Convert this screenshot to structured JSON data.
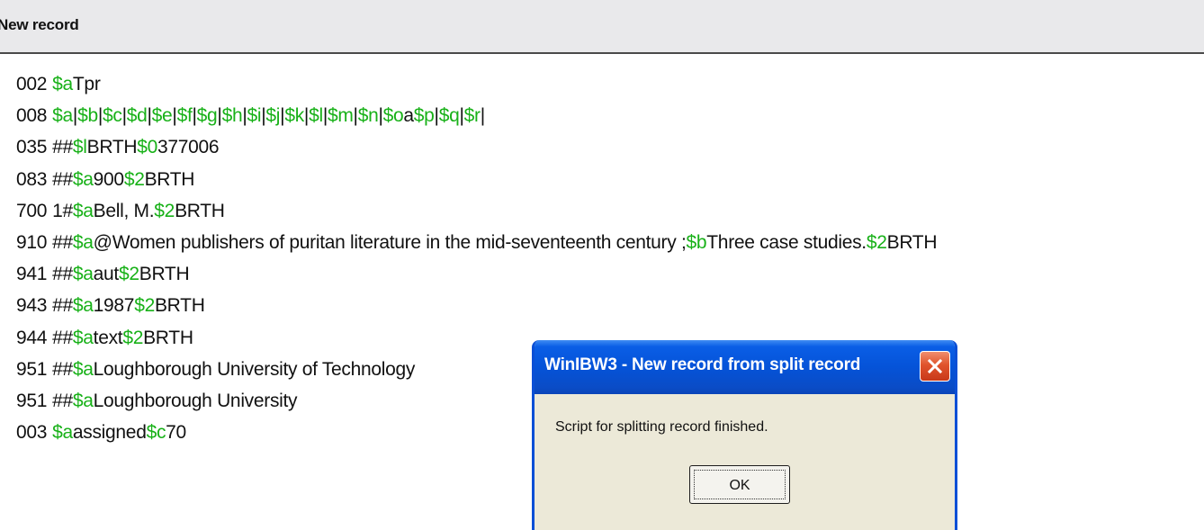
{
  "header": {
    "title": "New record"
  },
  "records": [
    {
      "tag": "002",
      "parts": [
        {
          "t": "$a",
          "s": 1
        },
        {
          "t": "Tpr"
        }
      ]
    },
    {
      "tag": "008",
      "parts": [
        {
          "t": "$a",
          "s": 1
        },
        {
          "t": "|"
        },
        {
          "t": "$b",
          "s": 1
        },
        {
          "t": "|"
        },
        {
          "t": "$c",
          "s": 1
        },
        {
          "t": "|"
        },
        {
          "t": "$d",
          "s": 1
        },
        {
          "t": "|"
        },
        {
          "t": "$e",
          "s": 1
        },
        {
          "t": "|"
        },
        {
          "t": "$f",
          "s": 1
        },
        {
          "t": "|"
        },
        {
          "t": "$g",
          "s": 1
        },
        {
          "t": "|"
        },
        {
          "t": "$h",
          "s": 1
        },
        {
          "t": "|"
        },
        {
          "t": "$i",
          "s": 1
        },
        {
          "t": "|"
        },
        {
          "t": "$j",
          "s": 1
        },
        {
          "t": "|"
        },
        {
          "t": "$k",
          "s": 1
        },
        {
          "t": "|"
        },
        {
          "t": "$l",
          "s": 1
        },
        {
          "t": "|"
        },
        {
          "t": "$m",
          "s": 1
        },
        {
          "t": "|"
        },
        {
          "t": "$n",
          "s": 1
        },
        {
          "t": "|"
        },
        {
          "t": "$o",
          "s": 1
        },
        {
          "t": "a"
        },
        {
          "t": "$p",
          "s": 1
        },
        {
          "t": "|"
        },
        {
          "t": "$q",
          "s": 1
        },
        {
          "t": "|"
        },
        {
          "t": "$r",
          "s": 1
        },
        {
          "t": "|"
        }
      ]
    },
    {
      "tag": "035",
      "parts": [
        {
          "t": "##"
        },
        {
          "t": "$l",
          "s": 1
        },
        {
          "t": "BRTH"
        },
        {
          "t": "$0",
          "s": 1
        },
        {
          "t": "377006"
        }
      ]
    },
    {
      "tag": "083",
      "parts": [
        {
          "t": "##"
        },
        {
          "t": "$a",
          "s": 1
        },
        {
          "t": "900"
        },
        {
          "t": "$2",
          "s": 1
        },
        {
          "t": "BRTH"
        }
      ]
    },
    {
      "tag": "700",
      "parts": [
        {
          "t": "1#"
        },
        {
          "t": "$a",
          "s": 1
        },
        {
          "t": "Bell, M."
        },
        {
          "t": "$2",
          "s": 1
        },
        {
          "t": "BRTH"
        }
      ]
    },
    {
      "tag": "910",
      "parts": [
        {
          "t": "##"
        },
        {
          "t": "$a",
          "s": 1
        },
        {
          "t": "@Women publishers of puritan literature in the mid-seventeenth century ;"
        },
        {
          "t": "$b",
          "s": 1
        },
        {
          "t": "Three case studies."
        },
        {
          "t": "$2",
          "s": 1
        },
        {
          "t": "BRTH"
        }
      ]
    },
    {
      "tag": "941",
      "parts": [
        {
          "t": "##"
        },
        {
          "t": "$a",
          "s": 1
        },
        {
          "t": "aut"
        },
        {
          "t": "$2",
          "s": 1
        },
        {
          "t": "BRTH"
        }
      ]
    },
    {
      "tag": "943",
      "parts": [
        {
          "t": "##"
        },
        {
          "t": "$a",
          "s": 1
        },
        {
          "t": "1987"
        },
        {
          "t": "$2",
          "s": 1
        },
        {
          "t": "BRTH"
        }
      ]
    },
    {
      "tag": "944",
      "parts": [
        {
          "t": "##"
        },
        {
          "t": "$a",
          "s": 1
        },
        {
          "t": "text"
        },
        {
          "t": "$2",
          "s": 1
        },
        {
          "t": "BRTH"
        }
      ]
    },
    {
      "tag": "951",
      "parts": [
        {
          "t": "##"
        },
        {
          "t": "$a",
          "s": 1
        },
        {
          "t": "Loughborough University of Technology"
        }
      ]
    },
    {
      "tag": "951",
      "parts": [
        {
          "t": "##"
        },
        {
          "t": "$a",
          "s": 1
        },
        {
          "t": "Loughborough University"
        }
      ]
    },
    {
      "tag": "003",
      "parts": [
        {
          "t": "$a",
          "s": 1
        },
        {
          "t": "assigned"
        },
        {
          "t": "$c",
          "s": 1
        },
        {
          "t": "70"
        }
      ]
    }
  ],
  "dialog": {
    "title": "WinIBW3 - New record from split record",
    "message": "Script for splitting record finished.",
    "ok_label": "OK",
    "close_icon": "close-x-icon"
  },
  "colors": {
    "subfield": "#18b118",
    "titlebar": "#0553d8",
    "close_button": "#e0542c",
    "dialog_face": "#ece9d8"
  }
}
